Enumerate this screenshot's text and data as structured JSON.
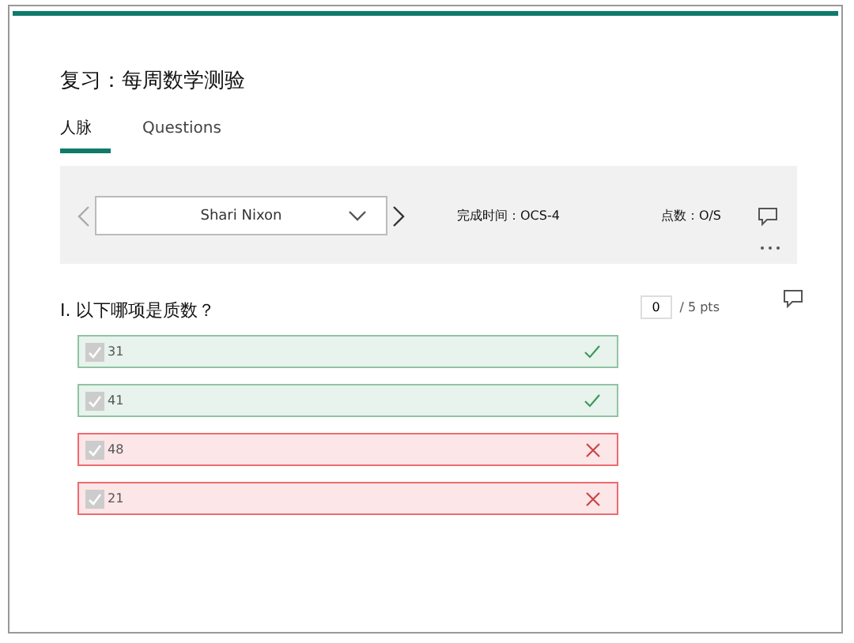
{
  "title": "复习：每周数学测验",
  "tabs": [
    {
      "label": "人脉",
      "selected": true
    },
    {
      "label": "Questions",
      "selected": false
    }
  ],
  "responder": {
    "name": "Shari Nixon",
    "completion": "完成时间：OCS-4",
    "score": "点数：O/S"
  },
  "question": {
    "number": "I.",
    "text": "以下哪项是质数？",
    "points_value": "0",
    "points_total": "/ 5 pts",
    "options": [
      {
        "label": "31",
        "checked": true,
        "kind": "correct"
      },
      {
        "label": "41",
        "checked": true,
        "kind": "correct"
      },
      {
        "label": "48",
        "checked": true,
        "kind": "incorrect"
      },
      {
        "label": "21",
        "checked": true,
        "kind": "incorrect"
      }
    ]
  }
}
